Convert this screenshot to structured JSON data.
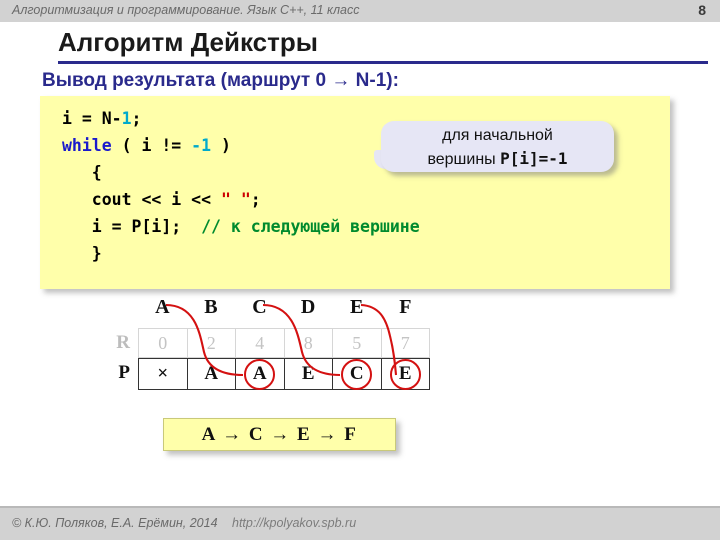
{
  "header": {
    "course_title": "Алгоритмизация и программирование. Язык C++, 11 класс",
    "page_number": "8"
  },
  "slide": {
    "title": "Алгоритм Дейкстры",
    "subtitle": "Вывод результата (маршрут 0 → N-1):"
  },
  "code": {
    "line1_a": "i = N-",
    "line1_num": "1",
    "line1_b": ";",
    "line2_kw": "while",
    "line2_a": " ( i != ",
    "line2_num": "-1",
    "line2_b": " )",
    "line3": "   {",
    "line4_a": "   cout << i << ",
    "line4_str": "\" \"",
    "line4_b": ";",
    "line5_a": "   i = P[i];  ",
    "line5_cmt": "// к следующей вершине",
    "line6": "   }"
  },
  "callout": {
    "line1": "для начальной",
    "line2_text": "вершины ",
    "line2_mono": "P[i]=-1"
  },
  "table": {
    "column_headers": [
      "A",
      "B",
      "C",
      "D",
      "E",
      "F"
    ],
    "row_r_label": "R",
    "row_r_values": [
      "0",
      "2",
      "4",
      "8",
      "5",
      "7"
    ],
    "row_p_label": "P",
    "row_p_values": [
      "×",
      "A",
      "A",
      "E",
      "C",
      "E"
    ],
    "row_p_circled": [
      false,
      false,
      true,
      false,
      true,
      true
    ]
  },
  "result": {
    "path": "A → C → E → F"
  },
  "footer": {
    "copyright": "© К.Ю. Поляков, Е.А. Ерёмин, 2014",
    "url": "http://kpolyakov.spb.ru"
  },
  "colors": {
    "accent_navy": "#2a2a8c",
    "code_bg": "#ffffaa",
    "callout_bg": "#e6e6f5",
    "arrow_red": "#d41111",
    "keyword_blue": "#1a1acc",
    "number_cyan": "#00aacc",
    "string_red": "#cc0000",
    "comment_green": "#008a2e",
    "bar_gray": "#d2d2d2"
  }
}
